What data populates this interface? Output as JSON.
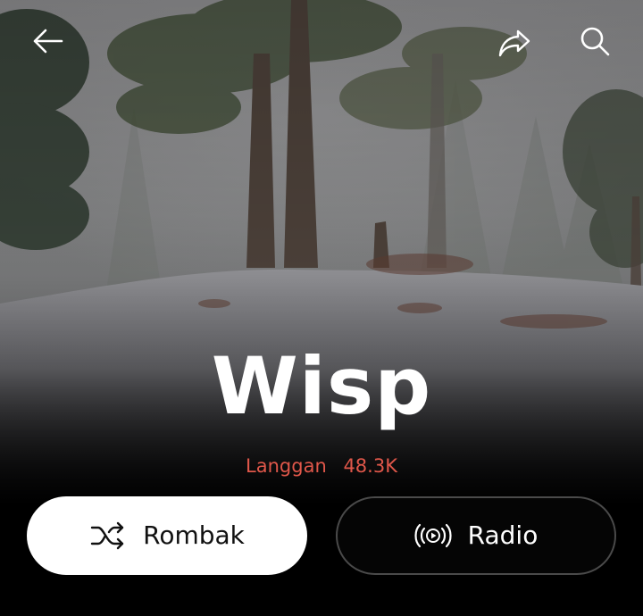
{
  "header": {
    "back_icon": "arrow-left-icon",
    "share_icon": "share-arrow-icon",
    "search_icon": "search-icon"
  },
  "artist": {
    "name": "Wisp",
    "subscribe_label": "Langgan",
    "subscriber_count": "48.3K"
  },
  "actions": {
    "shuffle_label": "Rombak",
    "shuffle_icon": "shuffle-icon",
    "radio_label": "Radio",
    "radio_icon": "radio-broadcast-icon"
  },
  "colors": {
    "subscribe_text": "#e0574a",
    "shuffle_button_bg": "#ffffff",
    "radio_button_bg": "#050505",
    "radio_button_border": "#4a4a4a"
  }
}
